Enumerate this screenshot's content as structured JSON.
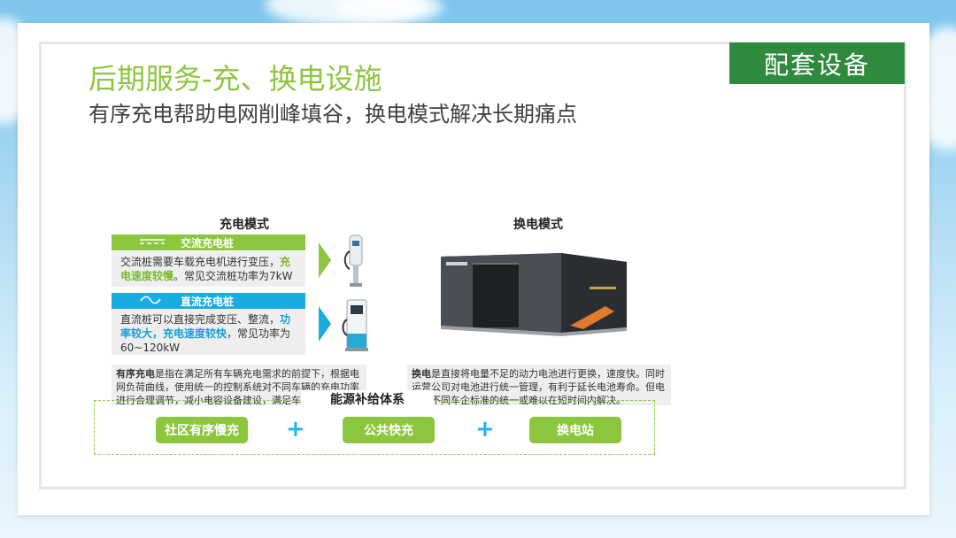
{
  "corner_tag": "配套设备",
  "title": "后期服务-充、换电设施",
  "subtitle": "有序充电帮助电网削峰填谷，换电模式解决长期痛点",
  "charging": {
    "header": "充电模式",
    "ac": {
      "icon": "ac-waveform-icon",
      "label": "交流充电桩",
      "text_a": "交流桩需要车载充电机进行变压，",
      "text_hl1": "充",
      "text_hl2": "电速度较慢",
      "text_b": "。常见交流桩功率为7kW"
    },
    "dc": {
      "icon": "dc-wave-icon",
      "label": "直流充电桩",
      "text_a": "直流桩可以直接完成变压、整流，",
      "text_hl1": "功",
      "text_hl2": "率较大，充电速度较快",
      "text_b": "，常见功率为60~120kW"
    },
    "note_bold": "有序充电",
    "note_text": "是指在满足所有车辆充电需求的前提下，根据电网负荷曲线，使用统一的控制系统对不同车辆的充电功率进行合理调节，减小电容设备建设，满足车主充电需求。"
  },
  "swap": {
    "header": "换电模式",
    "note_bold": "换电",
    "note_text": "是直接将电量不足的动力电池进行更换，速度快。同时运营公司对电池进行统一管理，有利于延长电池寿命。但电池和不同车企标准的统一或难以在短时间内解决。"
  },
  "energy": {
    "title": "能源补给体系",
    "items": [
      "社区有序慢充",
      "公共快充",
      "换电站"
    ],
    "plus": "+"
  },
  "colors": {
    "accent_green": "#8cc63e",
    "tag_green": "#2e8b3e",
    "accent_blue": "#1aace0"
  }
}
